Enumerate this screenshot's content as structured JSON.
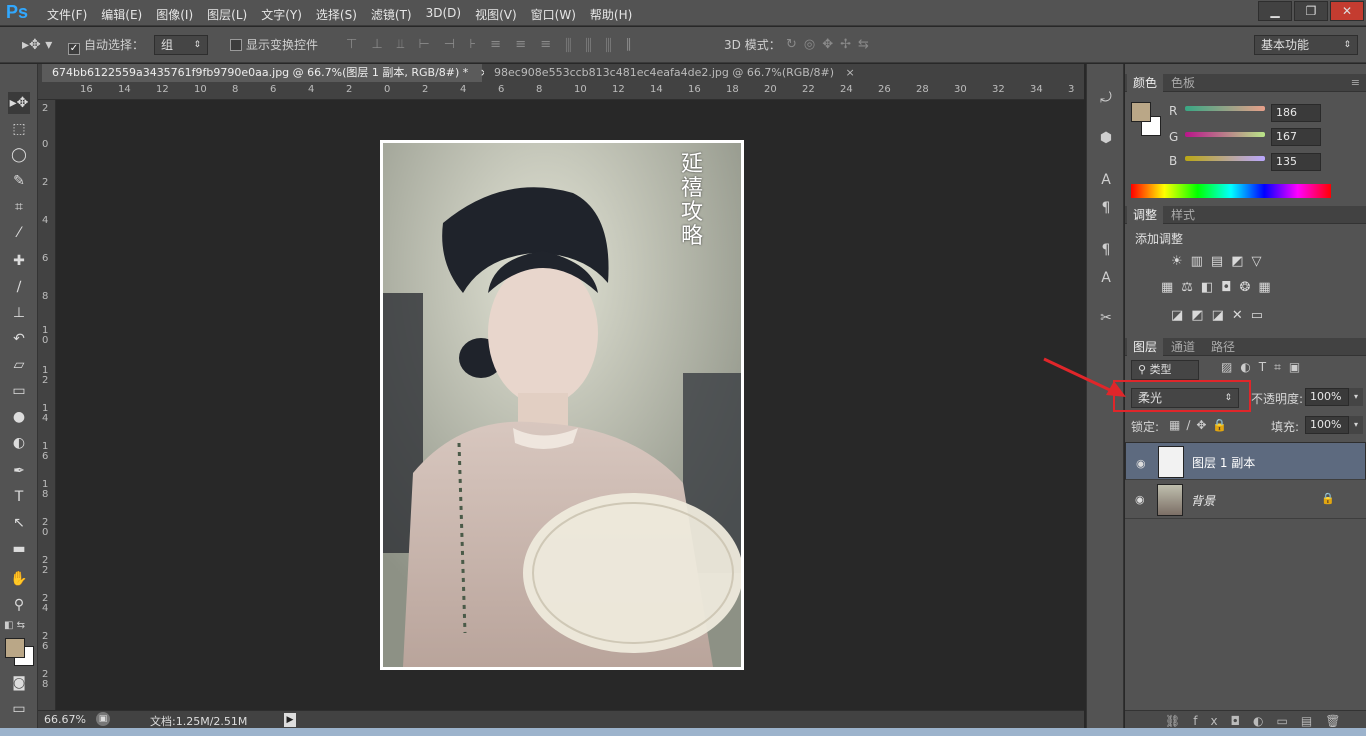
{
  "app": {
    "logo": "Ps"
  },
  "menu": [
    "文件(F)",
    "编辑(E)",
    "图像(I)",
    "图层(L)",
    "文字(Y)",
    "选择(S)",
    "滤镜(T)",
    "3D(D)",
    "视图(V)",
    "窗口(W)",
    "帮助(H)"
  ],
  "window_controls": {
    "minimize": "▁",
    "restore": "❐",
    "close": "✕"
  },
  "options": {
    "auto_select_label": "自动选择：",
    "auto_select_value": "组",
    "show_transform_label": "显示变换控件",
    "mode3d_label": "3D 模式：",
    "workspace": "基本功能"
  },
  "tabs": [
    {
      "label": "674bb6122559a3435761f9fb9790e0aa.jpg @ 66.7%(图层 1 副本, RGB/8#) *",
      "close": "×"
    },
    {
      "label": "98ec908e553ccb813c481ec4eafa4de2.jpg @ 66.7%(RGB/8#)",
      "close": "×"
    }
  ],
  "ruler_h": [
    "16",
    "14",
    "12",
    "10",
    "8",
    "6",
    "4",
    "2",
    "0",
    "2",
    "4",
    "6",
    "8",
    "10",
    "12",
    "14",
    "16",
    "18",
    "20",
    "22",
    "24",
    "26",
    "28",
    "30",
    "32",
    "34",
    "3"
  ],
  "ruler_v": [
    "2",
    "0",
    "2",
    "4",
    "6",
    "8",
    "10",
    "12",
    "14",
    "16",
    "18",
    "20",
    "22",
    "24",
    "26",
    "28"
  ],
  "status": {
    "zoom": "66.67%",
    "doc": "文档:1.25M/2.51M"
  },
  "color_panel": {
    "tabs": [
      "颜色",
      "色板"
    ],
    "fg_color": "#baa787",
    "r": {
      "label": "R",
      "value": "186"
    },
    "g": {
      "label": "G",
      "value": "167"
    },
    "b": {
      "label": "B",
      "value": "135"
    }
  },
  "adjust_panel": {
    "tabs": [
      "调整",
      "样式"
    ],
    "title": "添加调整"
  },
  "layers_panel": {
    "tabs": [
      "图层",
      "通道",
      "路径"
    ],
    "filter": "类型",
    "blend_mode": "柔光",
    "opacity_label": "不透明度:",
    "opacity": "100%",
    "lock_label": "锁定:",
    "fill_label": "填充:",
    "fill": "100%",
    "layers": [
      {
        "name": "图层 1 副本",
        "selected": true
      },
      {
        "name": "背景",
        "selected": false
      }
    ]
  },
  "photo_watermark": "延禧攻略",
  "colors": {
    "accent": "#31a8ff",
    "highlight_box": "#e0262a"
  }
}
